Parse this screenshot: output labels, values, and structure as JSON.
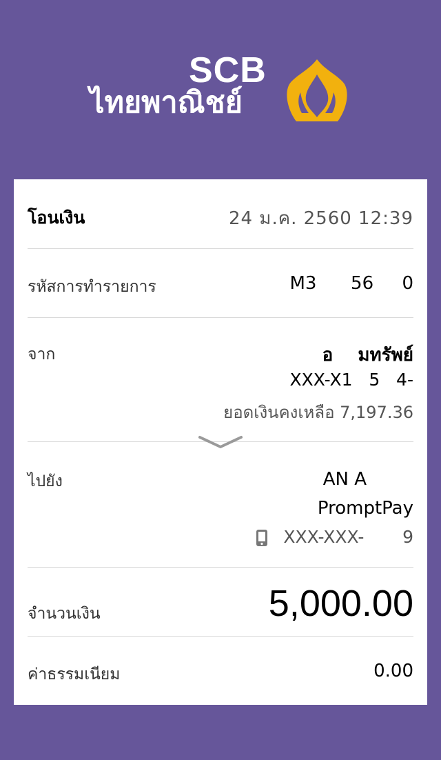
{
  "header": {
    "brand_en": "SCB",
    "brand_th": "ไทยพาณิชย์",
    "logo_icon": "scb-lotus-logo-icon",
    "logo_color": "#f2b10e"
  },
  "slip": {
    "title": "โอนเงิน",
    "datetime": "24 ม.ค. 2560  12:39",
    "ref_label": "รหัสการทำรายการ",
    "ref_value": "M3      56     0",
    "from_label": "จาก",
    "from_name": "อ    มทรัพย์",
    "from_account": "XXX-X1   5   4-",
    "balance_label": "ยอดเงินคงเหลือ",
    "balance_value": "7,197.36",
    "to_label": "ไปยัง",
    "to_name": "AN A",
    "to_service": "PromptPay",
    "to_phone": "XXX-XXX-       9",
    "amount_label": "จำนวนเงิน",
    "amount_value": "5,000.00",
    "fee_label": "ค่าธรรมเนียม",
    "fee_value": "0.00"
  },
  "colors": {
    "background": "#66569a",
    "card": "#ffffff",
    "divider": "#d9d9d9"
  }
}
